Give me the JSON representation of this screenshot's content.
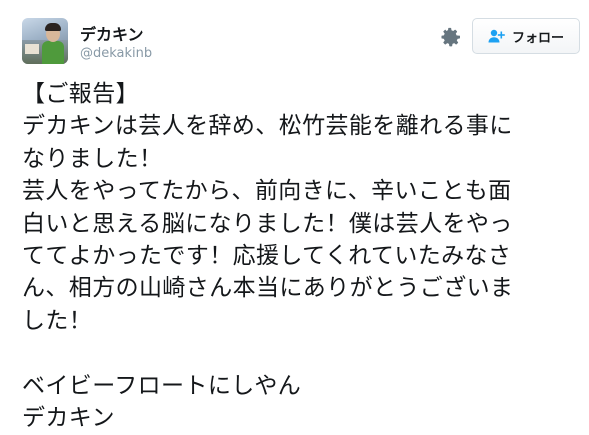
{
  "user": {
    "display_name": "デカキン",
    "handle": "@dekakinb"
  },
  "actions": {
    "settings_icon": "gear-icon",
    "follow_icon": "add-user-icon",
    "follow_label": "フォロー"
  },
  "tweet": {
    "lines": [
      "【ご報告】",
      "デカキンは芸人を辞め、松竹芸能を離れる事に",
      "なりました！",
      "芸人をやってたから、前向きに、辛いことも面",
      "白いと思える脳になりました！僕は芸人をやっ",
      "ててよかったです！応援してくれていたみなさ",
      "ん、相方の山崎さん本当にありがとうございま",
      "した！",
      "",
      "ベイビーフロートにしやん",
      "デカキン"
    ]
  },
  "colors": {
    "text": "#14171a",
    "secondary": "#8899a6",
    "icon": "#66757f",
    "button_border": "#d5dde3",
    "follow_icon": "#1da1f2"
  }
}
